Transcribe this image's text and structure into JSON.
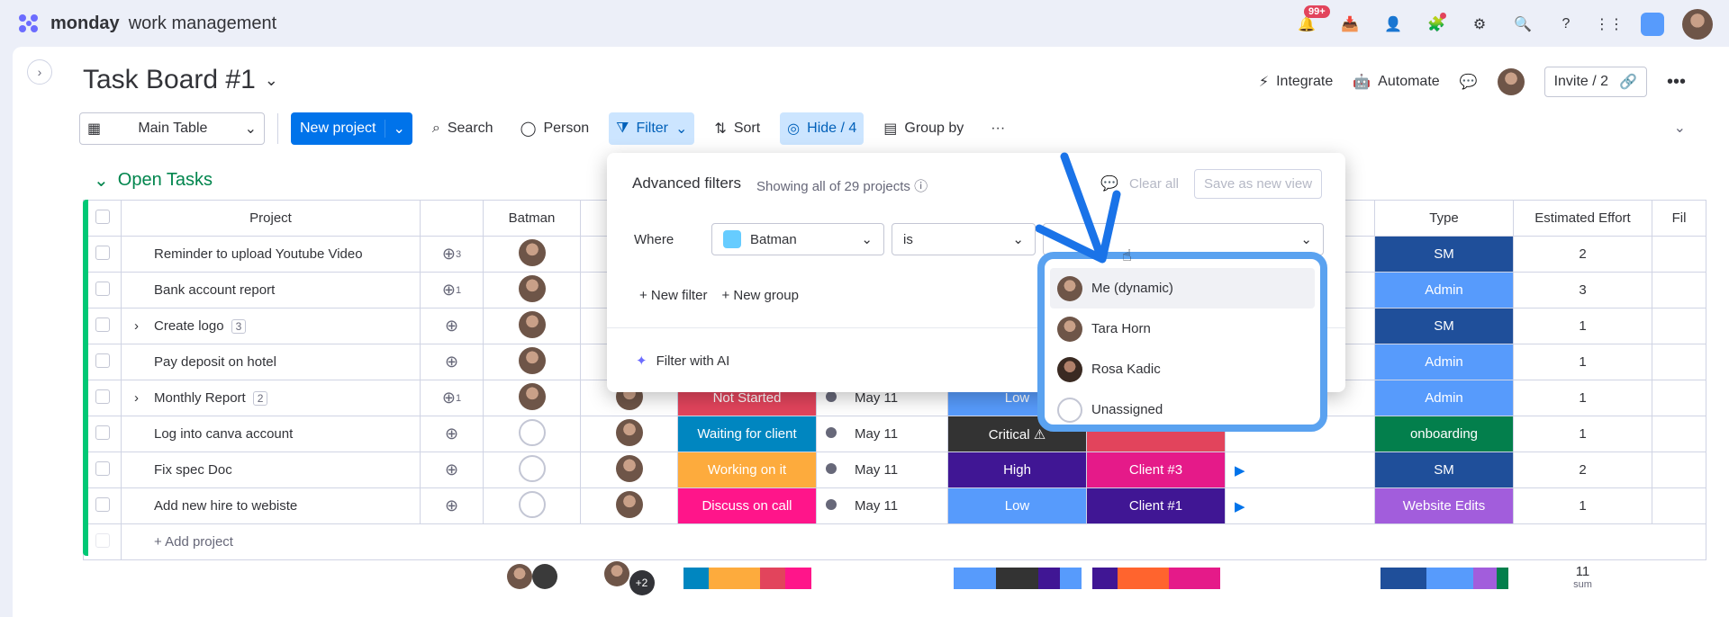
{
  "app": {
    "brand": "monday",
    "product": "work management",
    "notifications_badge": "99+"
  },
  "board": {
    "title": "Task Board #1",
    "integrate": "Integrate",
    "automate": "Automate",
    "invite": "Invite / 2"
  },
  "toolbar": {
    "main_table": "Main Table",
    "new_project": "New project",
    "search": "Search",
    "person": "Person",
    "filter": "Filter",
    "sort": "Sort",
    "hide": "Hide / 4",
    "group_by": "Group by"
  },
  "group": {
    "title": "Open Tasks"
  },
  "columns": {
    "project": "Project",
    "batman": "Batman",
    "type": "Type",
    "effort": "Estimated Effort",
    "file": "Fil"
  },
  "rows": [
    {
      "name": "Reminder to upload Youtube Video",
      "subitems": "",
      "updates": "3",
      "type": "SM",
      "type_color": "#1f4f9a",
      "effort": "2"
    },
    {
      "name": "Bank account report",
      "subitems": "",
      "updates": "1",
      "type": "Admin",
      "type_color": "#579bfc",
      "effort": "3"
    },
    {
      "name": "Create logo",
      "subitems": "3",
      "updates": "",
      "type": "SM",
      "type_color": "#1f4f9a",
      "effort": "1"
    },
    {
      "name": "Pay deposit on hotel",
      "subitems": "",
      "updates": "",
      "type": "Admin",
      "type_color": "#579bfc",
      "effort": "1"
    },
    {
      "name": "Monthly Report",
      "subitems": "2",
      "updates": "1",
      "status": "Not Started",
      "status_color": "#e2445c",
      "date": "May 11",
      "priority": "Low",
      "priority_color": "#579bfc",
      "type": "Admin",
      "type_color": "#579bfc",
      "effort": "1"
    },
    {
      "name": "Log into canva account",
      "subitems": "",
      "updates": "",
      "status": "Waiting for client",
      "status_color": "#0086c0",
      "date": "May 11",
      "priority": "Critical ⚠",
      "priority_color": "#333333",
      "client": "",
      "client_color": "#e2445c",
      "type": "onboarding",
      "type_color": "#037f4c",
      "effort": "1"
    },
    {
      "name": "Fix spec Doc",
      "subitems": "",
      "updates": "",
      "status": "Working on it",
      "status_color": "#fdab3d",
      "date": "May 11",
      "priority": "High",
      "priority_color": "#401694",
      "client": "Client #3",
      "client_color": "#e51a89",
      "type": "SM",
      "type_color": "#1f4f9a",
      "effort": "2"
    },
    {
      "name": "Add new hire to webiste",
      "subitems": "",
      "updates": "",
      "status": "Discuss on call",
      "status_color": "#ff158a",
      "date": "May 11",
      "priority": "Low",
      "priority_color": "#579bfc",
      "client": "Client #1",
      "client_color": "#401694",
      "type": "Website Edits",
      "type_color": "#a25ddc",
      "effort": "1"
    }
  ],
  "add_project": "+ Add project",
  "summary": {
    "effort_sum": "11",
    "sum_label": "sum",
    "avatars_more": "+2"
  },
  "filter": {
    "title": "Advanced filters",
    "subtitle": "Showing all of 29 projects",
    "clear_all": "Clear all",
    "save_view": "Save as new view",
    "where": "Where",
    "column": "Batman",
    "condition": "is",
    "new_filter": "+ New filter",
    "new_group": "+ New group",
    "ai": "Filter with AI"
  },
  "dropdown": {
    "options": [
      "Me (dynamic)",
      "Tara Horn",
      "Rosa Kadic",
      "Unassigned"
    ]
  }
}
